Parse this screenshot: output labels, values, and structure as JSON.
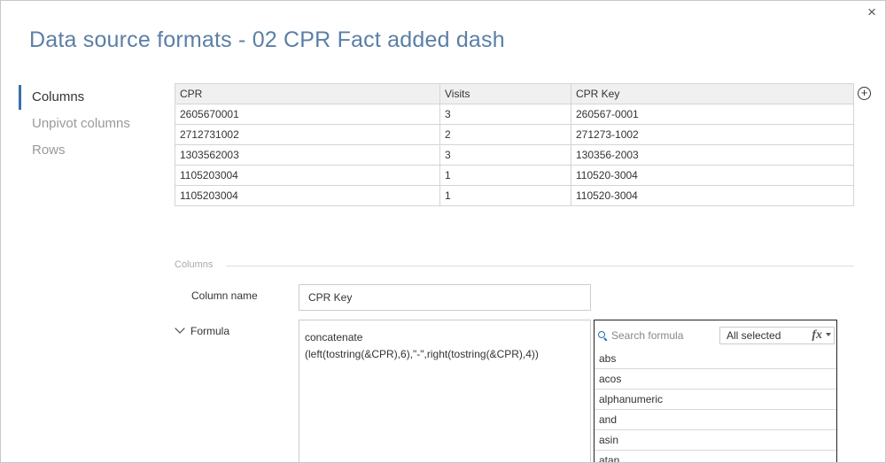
{
  "dialog": {
    "title": "Data source formats - 02 CPR Fact added dash",
    "close_label": "×"
  },
  "nav": {
    "items": [
      {
        "label": "Columns",
        "active": true
      },
      {
        "label": "Unpivot columns",
        "active": false
      },
      {
        "label": "Rows",
        "active": false
      }
    ]
  },
  "table": {
    "headers": [
      "CPR",
      "Visits",
      "CPR Key"
    ],
    "rows": [
      [
        "2605670001",
        "3",
        "260567-0001"
      ],
      [
        "2712731002",
        "2",
        "271273-1002"
      ],
      [
        "1303562003",
        "3",
        "130356-2003"
      ],
      [
        "1105203004",
        "1",
        "110520-3004"
      ],
      [
        "1105203004",
        "1",
        "110520-3004"
      ]
    ],
    "add_column_icon": "plus-circle-icon"
  },
  "columns_section": {
    "label": "Columns",
    "column_name_label": "Column name",
    "column_name_value": "CPR Key",
    "formula_label": "Formula",
    "formula_value": "concatenate\n(left(tostring(&CPR),6),\"-\",right(tostring(&CPR),4))"
  },
  "formula_panel": {
    "search_placeholder": "Search formula",
    "filter_value": "All selected",
    "fx_symbol": "fx",
    "functions": [
      "abs",
      "acos",
      "alphanumeric",
      "and",
      "asin",
      "atan"
    ]
  },
  "colors": {
    "title": "#5b7fa6",
    "nav_active_bar": "#3b6fa8",
    "search_icon": "#1e6fb8"
  }
}
